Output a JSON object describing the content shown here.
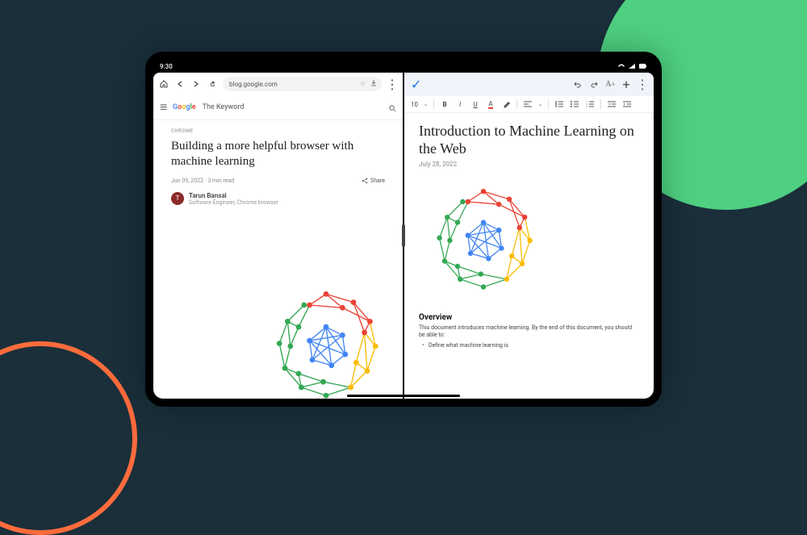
{
  "status": {
    "time": "9:30"
  },
  "browser": {
    "url": "blog.google.com",
    "brand": {
      "letters": [
        "G",
        "o",
        "o",
        "g",
        "l",
        "e"
      ],
      "section": "The Keyword"
    },
    "article": {
      "category": "CHROME",
      "headline": "Building a more helpful browser with machine learning",
      "date": "Jun 09, 2022",
      "read_time": "3 min read",
      "share_label": "Share",
      "author_initial": "T",
      "author": "Tarun Bansal",
      "author_role": "Software Engineer, Chrome browser"
    }
  },
  "docs": {
    "font_size": "10",
    "title": "Introduction to Machine Learning on the Web",
    "date": "July 28, 2022",
    "section_heading": "Overview",
    "intro": "This document introduces machine learning. By the end of this document, you should be able to:",
    "bullet": "Define what machine learning is"
  }
}
